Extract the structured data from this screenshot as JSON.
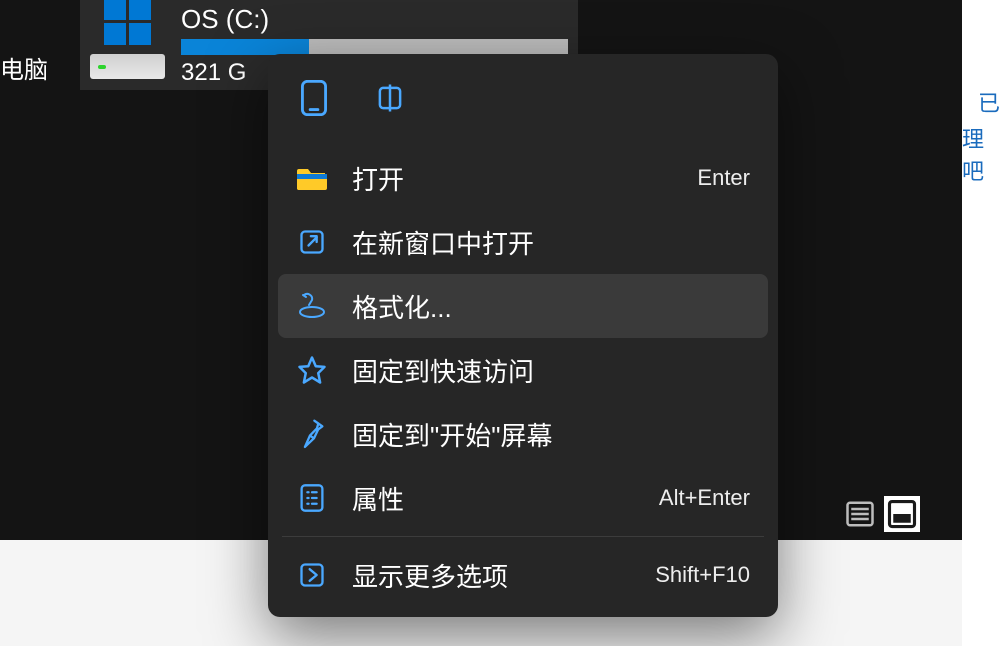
{
  "sidebar": {
    "label": "电脑"
  },
  "drive": {
    "name": "OS (C:)",
    "free_text": "321 G",
    "fill_percent": 33
  },
  "right_links": {
    "l1": "已",
    "l2": "理吧"
  },
  "context_menu": {
    "actions": {
      "open": {
        "label": "打开",
        "shortcut": "Enter"
      },
      "open_new_window": {
        "label": "在新窗口中打开"
      },
      "format": {
        "label": "格式化..."
      },
      "pin_quick": {
        "label": "固定到快速访问"
      },
      "pin_start": {
        "label": "固定到\"开始\"屏幕"
      },
      "properties": {
        "label": "属性",
        "shortcut": "Alt+Enter"
      },
      "more_options": {
        "label": "显示更多选项",
        "shortcut": "Shift+F10"
      }
    }
  }
}
